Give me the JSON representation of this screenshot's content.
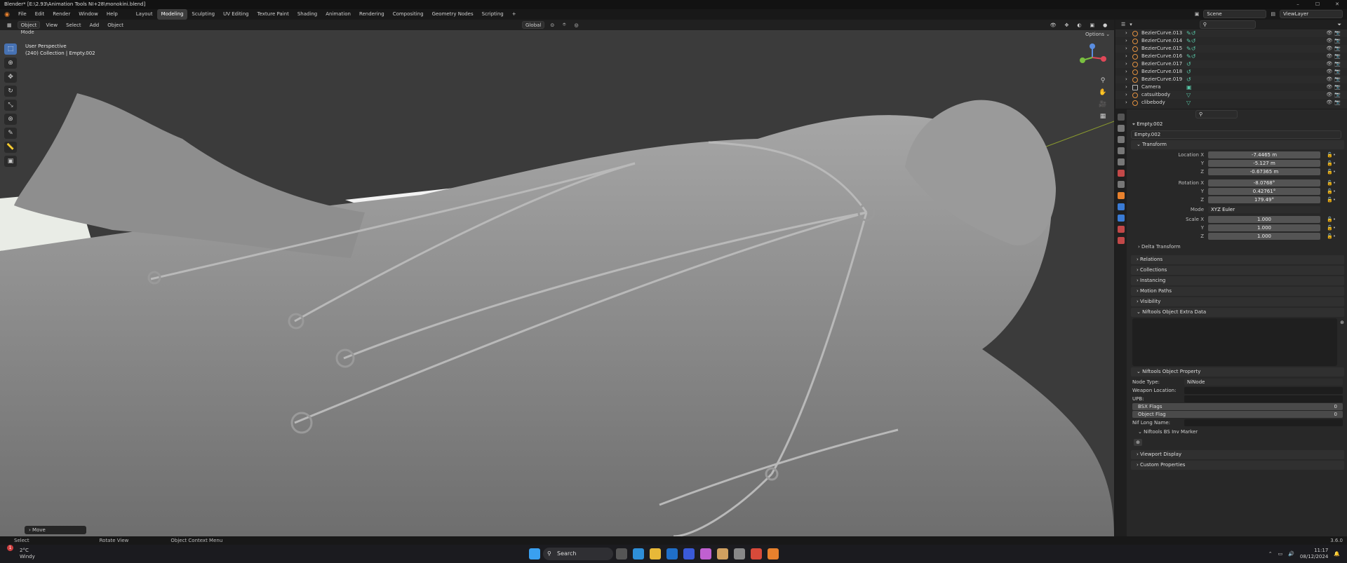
{
  "window": {
    "title": "Blender* [E:\\2.93\\Animation Tools NI+28\\monokini.blend]",
    "controls": [
      "–",
      "☐",
      "✕"
    ]
  },
  "topbar": {
    "menus": [
      "File",
      "Edit",
      "Render",
      "Window",
      "Help"
    ],
    "workspaces": [
      "Layout",
      "Modeling",
      "Sculpting",
      "UV Editing",
      "Texture Paint",
      "Shading",
      "Animation",
      "Rendering",
      "Compositing",
      "Geometry Nodes",
      "Scripting"
    ],
    "active_workspace": "Modeling",
    "add_tab": "+",
    "scene": "Scene",
    "view_layer": "ViewLayer"
  },
  "viewport": {
    "mode": "Object Mode",
    "menus": [
      "View",
      "Select",
      "Add",
      "Object"
    ],
    "orientation": "Global",
    "options": "Options ⌄",
    "info_line1": "User Perspective",
    "info_line2": "(240) Collection | Empty.002",
    "last_operator": "Move"
  },
  "outliner": {
    "rows": [
      {
        "name": "BezierCurve.013"
      },
      {
        "name": "BezierCurve.014"
      },
      {
        "name": "BezierCurve.015"
      },
      {
        "name": "BezierCurve.016"
      },
      {
        "name": "BezierCurve.017"
      },
      {
        "name": "BezierCurve.018"
      },
      {
        "name": "BezierCurve.019"
      },
      {
        "name": "Camera"
      },
      {
        "name": "catsuitbody"
      },
      {
        "name": "clibebody"
      }
    ]
  },
  "properties": {
    "object_name": "Empty.002",
    "object_field": "Empty.002",
    "transform": {
      "header": "Transform",
      "location": {
        "label": "Location X",
        "x": "-7.4465 m",
        "y": "-5.127 m",
        "z": "-0.67365 m"
      },
      "rotation": {
        "label": "Rotation X",
        "x": "-8.0768°",
        "y": "0.42761°",
        "z": "179.49°"
      },
      "mode_label": "Mode",
      "mode_value": "XYZ Euler",
      "scale": {
        "label": "Scale X",
        "x": "1.000",
        "y": "1.000",
        "z": "1.000"
      },
      "y_label": "Y",
      "z_label": "Z"
    },
    "delta_transform": "Delta Transform",
    "sections": [
      "Relations",
      "Collections",
      "Instancing",
      "Motion Paths",
      "Visibility"
    ],
    "niftools_extra": "Niftools Object Extra Data",
    "niftools_prop": "Niftools Object Property",
    "node_type_label": "Node Type:",
    "node_type_value": "NiNode",
    "weapon_location_label": "Weapon Location:",
    "upb_label": "UPB:",
    "bsx_flags_label": "BSX Flags",
    "bsx_flags_value": "0",
    "object_flag_label": "Object Flag",
    "object_flag_value": "0",
    "nif_long_name_label": "Nif Long Name:",
    "bs_inv_marker": "Niftools BS Inv Marker",
    "bottom_sections": [
      "Viewport Display",
      "Custom Properties"
    ]
  },
  "statusbar": {
    "items": [
      "Select",
      "Rotate View",
      "Object Context Menu"
    ],
    "version": "3.6.0"
  },
  "taskbar": {
    "weather_temp": "2°C",
    "weather_text": "Windy",
    "weather_badge": "1",
    "search": "Search",
    "time": "11:17",
    "date": "08/12/2024"
  }
}
